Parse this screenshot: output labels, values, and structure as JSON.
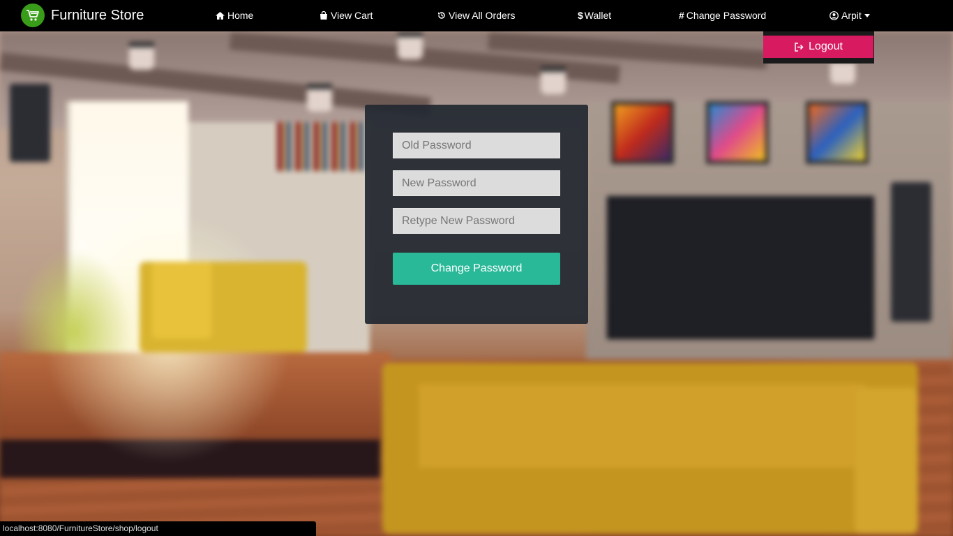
{
  "brand": {
    "name": "Furniture Store",
    "logo_icon": "shopping-cart-icon",
    "logo_color": "#3a9d1a"
  },
  "nav": {
    "items": [
      {
        "label": "Home",
        "icon": "home-icon"
      },
      {
        "label": "View Cart",
        "icon": "shopping-bag-icon"
      },
      {
        "label": "View All Orders",
        "icon": "history-icon"
      },
      {
        "label": "Wallet",
        "icon": "dollar-icon"
      },
      {
        "label": "Change Password",
        "icon": "hashtag-icon"
      }
    ],
    "user": {
      "label": "Arpit",
      "icon": "user-circle-icon"
    }
  },
  "dropdown": {
    "logout_label": "Logout",
    "logout_icon": "sign-out-icon",
    "logout_color": "#d81b60"
  },
  "form": {
    "old_password_placeholder": "Old Password",
    "new_password_placeholder": "New Password",
    "retype_password_placeholder": "Retype New Password",
    "old_password_value": "",
    "new_password_value": "",
    "retype_password_value": "",
    "submit_label": "Change Password",
    "accent_color": "#2ab998"
  },
  "statusbar": {
    "url": "localhost:8080/FurnitureStore/shop/logout"
  }
}
